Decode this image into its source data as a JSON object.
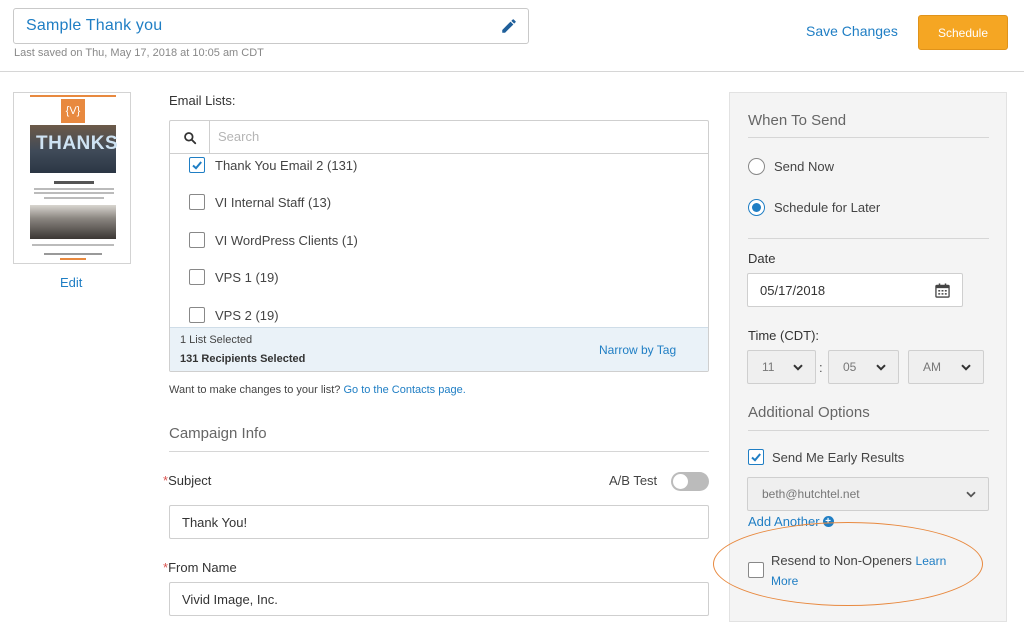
{
  "header": {
    "title": "Sample Thank you",
    "last_saved": "Last saved on Thu, May 17, 2018 at 10:05 am CDT",
    "save_changes": "Save Changes",
    "schedule": "Schedule"
  },
  "thumbnail": {
    "logo_text": "{V}",
    "hero_text": "THANKS",
    "edit_label": "Edit"
  },
  "email_lists": {
    "label": "Email Lists:",
    "search_placeholder": "Search",
    "items": [
      {
        "label": "Thank You Email 2 (131)",
        "checked": true
      },
      {
        "label": "VI Internal Staff (13)",
        "checked": false
      },
      {
        "label": "VI WordPress Clients (1)",
        "checked": false
      },
      {
        "label": "VPS 1 (19)",
        "checked": false
      },
      {
        "label": "VPS 2 (19)",
        "checked": false
      }
    ],
    "selected_count": "1 List Selected",
    "recipients": "131 Recipients Selected",
    "narrow_by_tag": "Narrow by Tag",
    "change_note": "Want to make changes to your list?",
    "contacts_link": "Go to the Contacts page."
  },
  "campaign_info": {
    "heading": "Campaign Info",
    "required_mark": "*",
    "subject_label": "Subject",
    "ab_test_label": "A/B Test",
    "subject_value": "Thank You!",
    "from_name_label": "From Name",
    "from_name_value": "Vivid Image, Inc."
  },
  "when_to_send": {
    "heading": "When To Send",
    "send_now": "Send Now",
    "schedule_later": "Schedule for Later",
    "selected": "schedule_later",
    "date_label": "Date",
    "date_value": "05/17/2018",
    "time_label": "Time (CDT):",
    "hour": "11",
    "separator": ":",
    "minute": "05",
    "ampm": "AM"
  },
  "additional_options": {
    "heading": "Additional Options",
    "early_results": "Send Me Early Results",
    "early_results_checked": true,
    "email_value": "beth@hutchtel.net",
    "add_another": "Add Another",
    "resend": "Resend to Non-Openers",
    "learn_more": "Learn More",
    "resend_checked": false
  },
  "colors": {
    "accent": "#1f7ec4",
    "schedule_button": "#f5a623",
    "annotation": "#e8893f"
  }
}
